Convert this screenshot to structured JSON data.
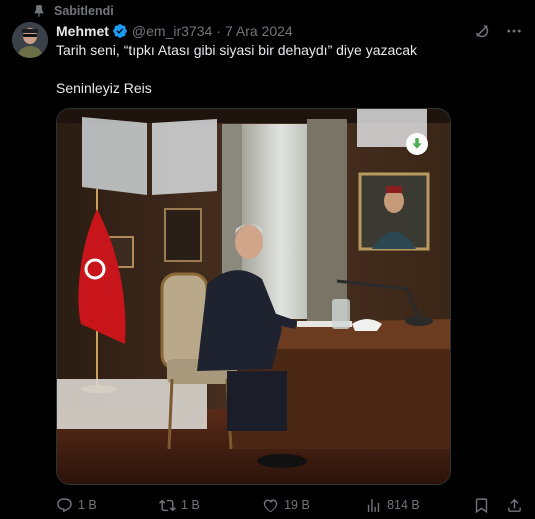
{
  "pinned": {
    "label": "Sabitlendi"
  },
  "author": {
    "name": "Mehmet",
    "handle": "@em_ir3734",
    "separator": "·",
    "date": "7 Ara 2024"
  },
  "post": {
    "line1": "Tarih seni, “tıpkı Atası gibi siyasi bir dehaydı” diye yazacak",
    "line2": "Seninleyiz Reis"
  },
  "actions": {
    "replies": "1 B",
    "reposts": "1 B",
    "likes": "19 B",
    "views": "814 B"
  },
  "colors": {
    "background": "#000000",
    "text": "#e7e9ea",
    "muted": "#71767b",
    "verified": "#1d9bf0",
    "media_badge": "#4caf50"
  },
  "icons": [
    "pin-icon",
    "verified-icon",
    "grok-icon",
    "more-icon",
    "reply-icon",
    "repost-icon",
    "like-icon",
    "views-icon",
    "bookmark-icon",
    "share-icon",
    "download-badge-icon"
  ]
}
